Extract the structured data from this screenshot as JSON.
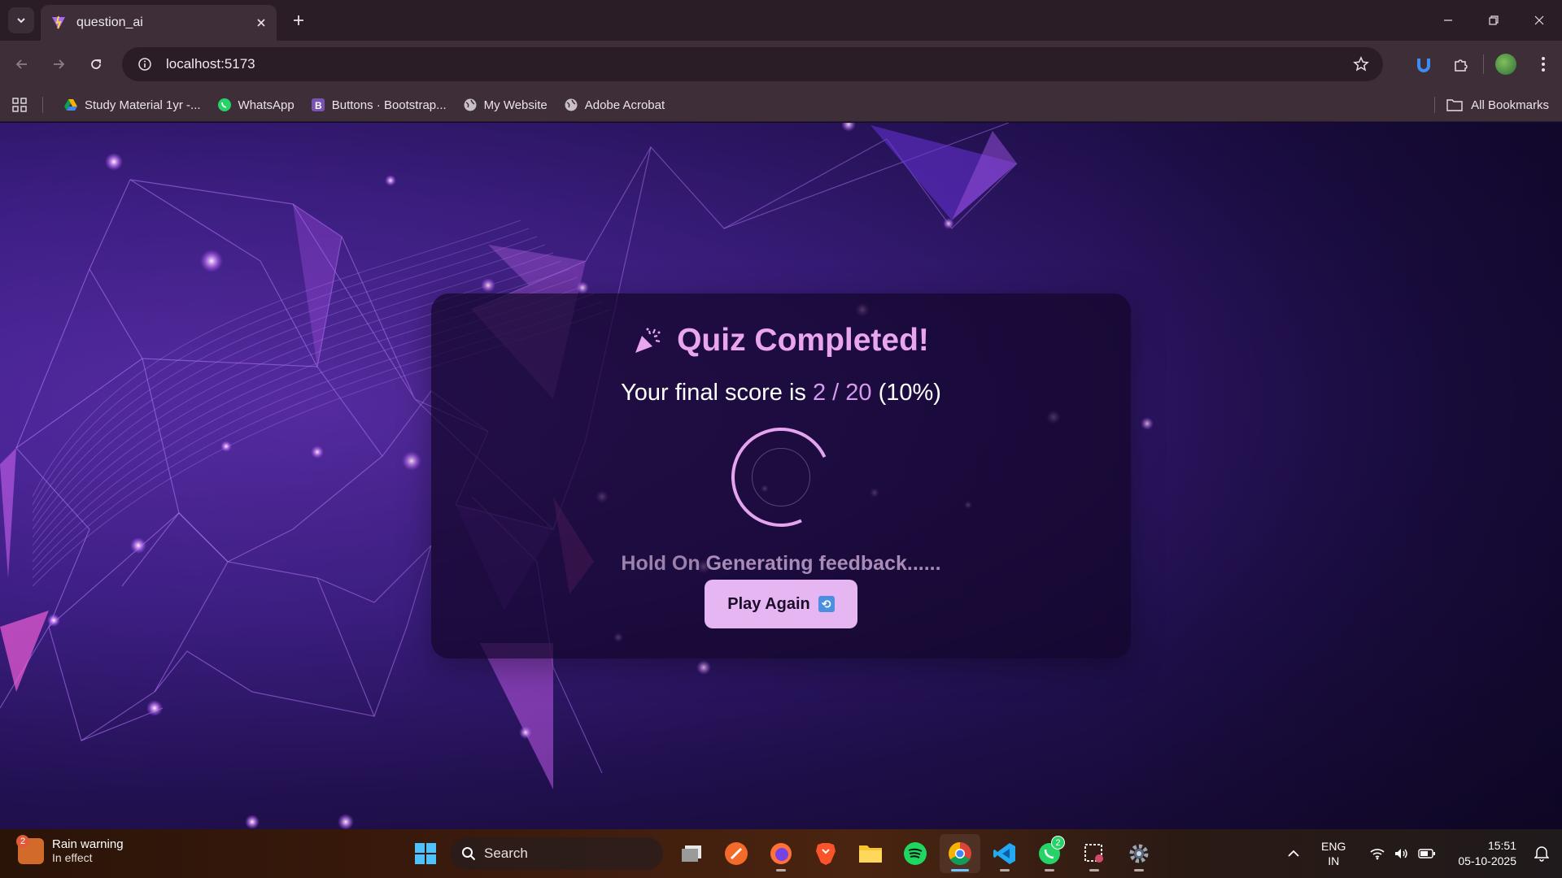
{
  "browser": {
    "tab_title": "question_ai",
    "url": "localhost:5173",
    "bookmarks": [
      {
        "label": "Study Material 1yr -...",
        "icon": "google-drive-icon"
      },
      {
        "label": "WhatsApp",
        "icon": "whatsapp-icon"
      },
      {
        "label": "Buttons · Bootstrap...",
        "icon": "bootstrap-icon"
      },
      {
        "label": "My Website",
        "icon": "globe-icon"
      },
      {
        "label": "Adobe Acrobat",
        "icon": "globe-icon"
      }
    ],
    "all_bookmarks_label": "All Bookmarks"
  },
  "quiz": {
    "title": "Quiz Completed!",
    "title_icon": "party-popper-icon",
    "score_prefix": "Your final score is",
    "score_value": "2 / 20",
    "score_percent": "(10%)",
    "status_hold": "Hold On",
    "status_text": "Generating feedback......",
    "play_again_label": "Play Again",
    "play_again_icon": "repeat-icon",
    "accent_color": "#e9a6ee"
  },
  "taskbar": {
    "weather_title": "Rain warning",
    "weather_sub": "In effect",
    "weather_badge": "2",
    "search_placeholder": "Search",
    "lang_line1": "ENG",
    "lang_line2": "IN",
    "time": "15:51",
    "date": "05-10-2025",
    "whatsapp_badge": "2"
  }
}
